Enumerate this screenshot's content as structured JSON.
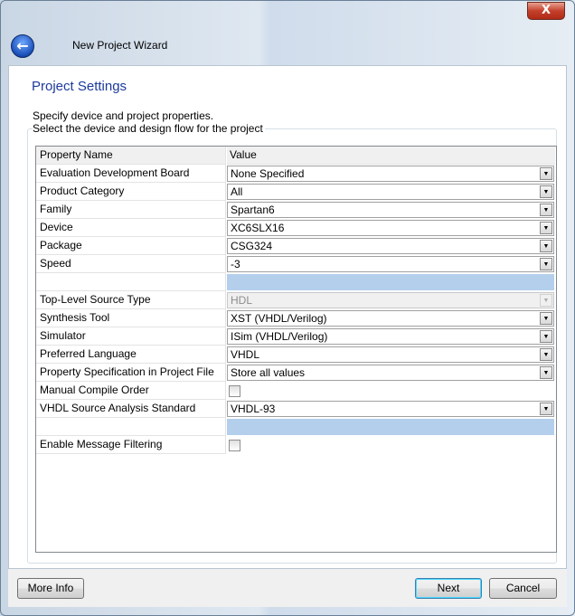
{
  "window": {
    "title": "New Project Wizard",
    "close_label": "X"
  },
  "page": {
    "title": "Project Settings",
    "description": "Specify device and project properties.",
    "group_label": "Select the device and design flow for the project"
  },
  "table": {
    "headers": [
      "Property Name",
      "Value"
    ],
    "rows": [
      {
        "name": "Evaluation Development Board",
        "type": "combo",
        "value": "None Specified"
      },
      {
        "name": "Product Category",
        "type": "combo",
        "value": "All"
      },
      {
        "name": "Family",
        "type": "combo",
        "value": "Spartan6"
      },
      {
        "name": "Device",
        "type": "combo",
        "value": "XC6SLX16"
      },
      {
        "name": "Package",
        "type": "combo",
        "value": "CSG324"
      },
      {
        "name": "Speed",
        "type": "combo",
        "value": "-3"
      },
      {
        "name": "",
        "type": "separator",
        "value": ""
      },
      {
        "name": "Top-Level Source Type",
        "type": "combo-disabled",
        "value": "HDL"
      },
      {
        "name": "Synthesis Tool",
        "type": "combo",
        "value": "XST (VHDL/Verilog)"
      },
      {
        "name": "Simulator",
        "type": "combo",
        "value": "ISim (VHDL/Verilog)"
      },
      {
        "name": "Preferred Language",
        "type": "combo",
        "value": "VHDL"
      },
      {
        "name": "Property Specification in Project File",
        "type": "combo",
        "value": "Store all values"
      },
      {
        "name": "Manual Compile Order",
        "type": "checkbox",
        "checked": false
      },
      {
        "name": "VHDL Source Analysis Standard",
        "type": "combo",
        "value": "VHDL-93"
      },
      {
        "name": "",
        "type": "separator",
        "value": ""
      },
      {
        "name": "Enable Message Filtering",
        "type": "checkbox",
        "checked": false
      }
    ]
  },
  "buttons": {
    "more_info": "More Info",
    "next": "Next",
    "cancel": "Cancel"
  },
  "colors": {
    "title": "#1c3a9c",
    "separator": "#b3cfec"
  }
}
